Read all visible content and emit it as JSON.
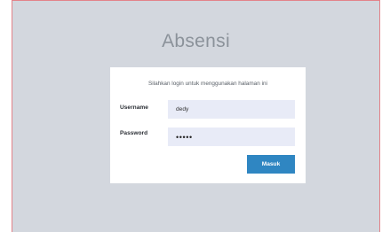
{
  "app": {
    "title": "Absensi"
  },
  "login": {
    "instruction": "Silahkan login untuk menggunakan halaman ini",
    "username_label": "Username",
    "username_value": "dedy",
    "password_label": "Password",
    "password_value": "•••••",
    "submit_label": "Masuk"
  },
  "colors": {
    "background": "#d3d7de",
    "frame_border": "#e3838a",
    "input_background": "#e8ebf7",
    "button": "#2f86c2"
  }
}
